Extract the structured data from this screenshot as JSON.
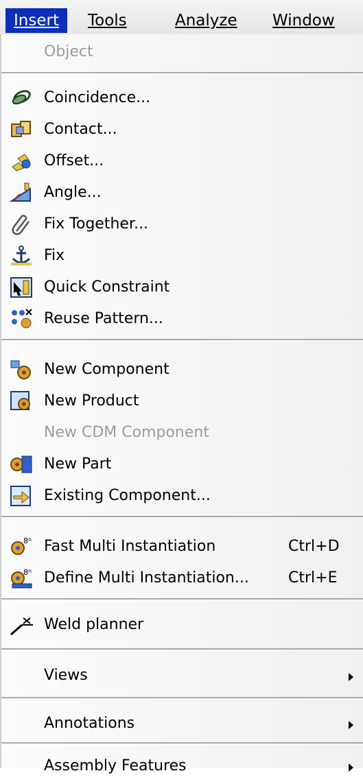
{
  "menubar": {
    "items": [
      "Insert",
      "Tools",
      "Analyze",
      "Window"
    ]
  },
  "menu": {
    "object": "Object",
    "coincidence": "Coincidence...",
    "contact": "Contact...",
    "offset": "Offset...",
    "angle": "Angle...",
    "fix_together": "Fix Together...",
    "fix": "Fix",
    "quick_constraint": "Quick Constraint",
    "reuse_pattern": "Reuse Pattern...",
    "new_component": "New Component",
    "new_product": "New Product",
    "new_cdm_component": "New CDM Component",
    "new_part": "New Part",
    "existing_component": "Existing Component...",
    "fast_multi": "Fast Multi Instantiation",
    "fast_multi_shortcut": "Ctrl+D",
    "define_multi": "Define Multi Instantiation...",
    "define_multi_shortcut": "Ctrl+E",
    "weld_planner": "Weld planner",
    "views": "Views",
    "annotations": "Annotations",
    "assembly_features": "Assembly Features"
  },
  "colors": {
    "active_menu_bg": "#0b2fb8",
    "disabled_text": "#9a9a9a"
  }
}
